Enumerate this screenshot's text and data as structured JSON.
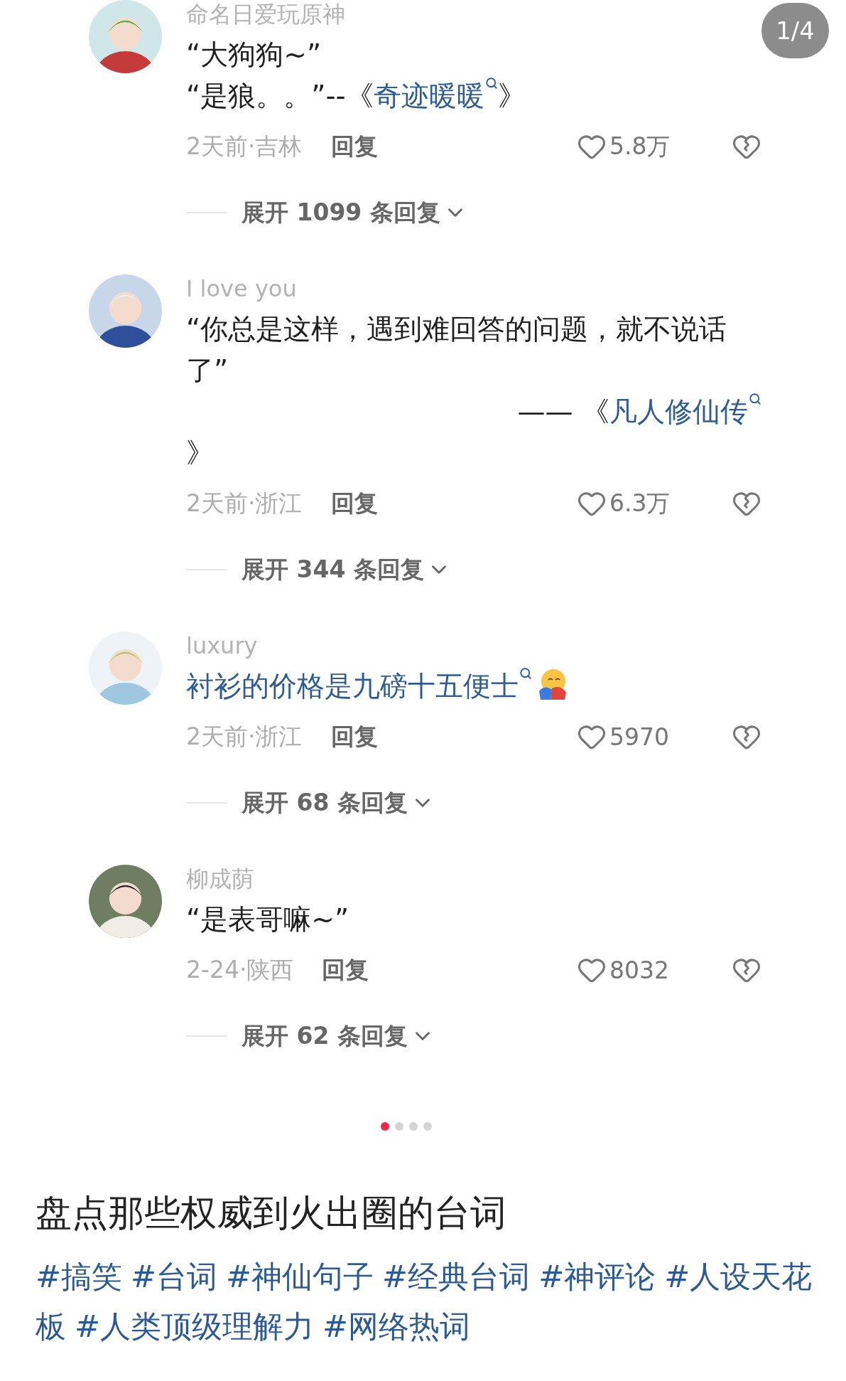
{
  "page_counter": "1/4",
  "comments": [
    {
      "user": "命名日爱玩原神",
      "lines": [
        {
          "right_aligned": false,
          "segments": [
            {
              "kind": "text",
              "text": "“大狗狗~”"
            }
          ]
        },
        {
          "right_aligned": false,
          "segments": [
            {
              "kind": "text",
              "text": "“是狼。。”--《"
            },
            {
              "kind": "link",
              "text": "奇迹暖暖"
            },
            {
              "kind": "text",
              "text": "》"
            }
          ]
        }
      ],
      "time": "2天前·吉林",
      "reply": "回复",
      "likes": "5.8万",
      "expand": "展开 1099 条回复"
    },
    {
      "user": "I love you",
      "lines": [
        {
          "right_aligned": false,
          "segments": [
            {
              "kind": "text",
              "text": "“你总是这样，遇到难回答的问题，就不说话了”"
            }
          ]
        },
        {
          "right_aligned": true,
          "segments": [
            {
              "kind": "text",
              "text": "—— 《"
            },
            {
              "kind": "link",
              "text": "凡人修仙传"
            }
          ]
        },
        {
          "right_aligned": false,
          "segments": [
            {
              "kind": "text",
              "text": "》"
            }
          ]
        }
      ],
      "time": "2天前·浙江",
      "reply": "回复",
      "likes": "6.3万",
      "expand": "展开 344 条回复"
    },
    {
      "user": "luxury",
      "lines": [
        {
          "right_aligned": false,
          "segments": [
            {
              "kind": "link",
              "text": "衬衫的价格是九磅十五便士"
            },
            {
              "kind": "emoji"
            }
          ]
        }
      ],
      "time": "2天前·浙江",
      "reply": "回复",
      "likes": "5970",
      "expand": "展开 68 条回复"
    },
    {
      "user": "柳成荫",
      "lines": [
        {
          "right_aligned": false,
          "segments": [
            {
              "kind": "text",
              "text": "“是表哥嘛~”"
            }
          ]
        }
      ],
      "time": "2-24·陕西",
      "reply": "回复",
      "likes": "8032",
      "expand": "展开 62 条回复"
    }
  ],
  "pager_dots": [
    {
      "selected": true
    },
    {
      "selected": false
    },
    {
      "selected": false
    },
    {
      "selected": false
    }
  ],
  "title": "盘点那些权威到火出圈的台词",
  "tags": [
    "#搞笑",
    "#台词",
    "#神仙句子",
    "#经典台词",
    "#神评论",
    "#人设天花板",
    "#人类顶级理解力",
    "#网络热词"
  ]
}
